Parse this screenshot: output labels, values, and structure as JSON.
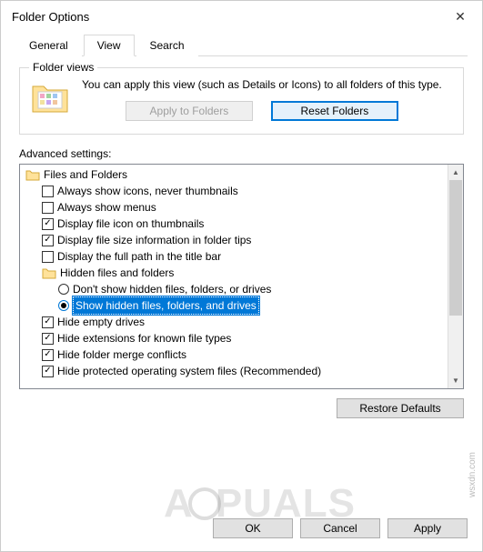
{
  "title": "Folder Options",
  "tabs": {
    "general": "General",
    "view": "View",
    "search": "Search"
  },
  "folder_views": {
    "legend": "Folder views",
    "text": "You can apply this view (such as Details or Icons) to all folders of this type.",
    "apply_btn": "Apply to Folders",
    "reset_btn": "Reset Folders"
  },
  "advanced_label": "Advanced settings:",
  "tree": {
    "root": "Files and Folders",
    "items": [
      {
        "label": "Always show icons, never thumbnails",
        "checked": false
      },
      {
        "label": "Always show menus",
        "checked": false
      },
      {
        "label": "Display file icon on thumbnails",
        "checked": true
      },
      {
        "label": "Display file size information in folder tips",
        "checked": true
      },
      {
        "label": "Display the full path in the title bar",
        "checked": false
      }
    ],
    "hidden_group": "Hidden files and folders",
    "hidden_options": [
      {
        "label": "Don't show hidden files, folders, or drives",
        "selected": false
      },
      {
        "label": "Show hidden files, folders, and drives",
        "selected": true
      }
    ],
    "items2": [
      {
        "label": "Hide empty drives",
        "checked": true
      },
      {
        "label": "Hide extensions for known file types",
        "checked": true
      },
      {
        "label": "Hide folder merge conflicts",
        "checked": true
      },
      {
        "label": "Hide protected operating system files (Recommended)",
        "checked": true
      }
    ]
  },
  "restore_btn": "Restore Defaults",
  "buttons": {
    "ok": "OK",
    "cancel": "Cancel",
    "apply": "Apply"
  },
  "watermark": {
    "pre": "A",
    "post": "PUALS"
  },
  "site": "wsxdn.com"
}
